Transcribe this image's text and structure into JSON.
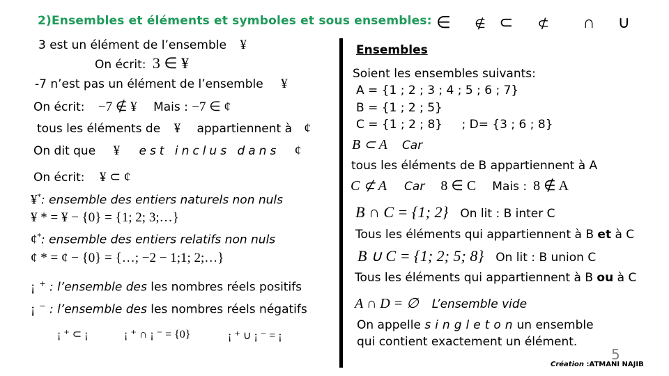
{
  "title": "2)Ensembles et éléments et symboles et sous ensembles:",
  "symbols": [
    {
      "name": "element-of",
      "glyph": "∈"
    },
    {
      "name": "not-element-of",
      "glyph": "∉"
    },
    {
      "name": "subset",
      "glyph": "⊂"
    },
    {
      "name": "not-subset",
      "glyph": "⊄"
    },
    {
      "name": "intersection",
      "glyph": "∩"
    },
    {
      "name": "union",
      "glyph": "∪"
    }
  ],
  "left": {
    "l1_text": "3 est un élément de l’ensemble",
    "l1_set": "¥",
    "l2_label": "On écrit:",
    "l2_math": "3 ∈ ¥",
    "l3_text": "-7  n’est pas un élément de l’ensemble",
    "l3_set": "¥",
    "l4_label": "On écrit:",
    "l4_math": "−7 ∉ ¥",
    "l4_but": "Mais :",
    "l4_math2": "−7 ∈ ¢",
    "l5_text1": "tous les éléments de",
    "l5_set1": "¥",
    "l5_text2": "appartiennent à",
    "l5_set2": "¢",
    "l6_text1": "On dit que",
    "l6_set1": "¥",
    "l6_text2": "est inclus dans",
    "l6_set2": "¢",
    "l7_label": "On écrit:",
    "l7_math": "¥  ⊂ ¢",
    "n_star_def_sym": "¥",
    "n_star_def_sup": "*",
    "n_star_def_text": ": ensemble des entiers naturels non nuls",
    "n_star_eq": "¥ * = ¥ − {0} = {1; 2; 3;…}",
    "z_star_def_sym": "¢",
    "z_star_def_sup": "*",
    "z_star_def_text": ": ensemble des entiers relatifs non nuls",
    "z_star_eq": "¢ * = ¢ − {0} = {…; −2 − 1;1; 2;…}",
    "rplus_sym": "¡",
    "rplus_sup": "+",
    "rplus_it": " : l’ensemble des",
    "rplus_text": " les nombres  réels positifs",
    "rminus_sym": "¡",
    "rminus_sup": "−",
    "rminus_it": " : l’ensemble des",
    "rminus_text": " les nombres  réels négatifs",
    "r_rel1": "¡ ⁺ ⊂ ¡",
    "r_rel2": "¡ ⁺ ∩ ¡ ⁻ = {0}",
    "r_rel3": "¡ ⁺ ∪ ¡ ⁻ = ¡"
  },
  "right": {
    "heading": "Ensembles",
    "intro": "Soient les ensembles suivants:",
    "set_a": "A = {1 ; 2 ; 3 ; 4 ; 5 ; 6 ; 7}",
    "set_b": "B = {1 ; 2 ; 5}",
    "set_c": "C = {1 ; 2 ; 8}",
    "set_d": "; D= {3 ; 6 ; 8}",
    "b_sub_a": "B ⊂ A",
    "car1": "Car",
    "b_in_a_text": "tous les éléments de  B  appartiennent à A",
    "c_notsub_a": "C ⊄ A",
    "car2": "Car",
    "eight_in_c": "8 ∈ C",
    "but": "Mais :",
    "eight_notin_a": "8 ∉ A",
    "b_inter_c": "B ∩ C = {1; 2}",
    "inter_read": "On lit : B inter C",
    "inter_desc_pre": "Tous les éléments qui appartiennent à B ",
    "inter_desc_bold": "et",
    "inter_desc_post": " à C",
    "b_union_c": "B ∪ C = {1; 2; 5; 8}",
    "union_read": "On lit : B union C",
    "union_desc_pre": "Tous les éléments qui appartiennent à B ",
    "union_desc_bold": "ou",
    "union_desc_post": " à C",
    "a_inter_d": "A ∩ D = ∅",
    "empty_label": "L’ensemble vide",
    "singleton_pre": "On appelle",
    "singleton_word": "singleton",
    "singleton_post": "un ensemble",
    "singleton_line2": "qui contient exactement un élément."
  },
  "footer": {
    "page_number": "5",
    "credit_label": "Création",
    "credit_name": " :ATMANI NAJIB"
  },
  "colors": {
    "title": "#1f9a5a",
    "page_number": "#808080",
    "divider": "#000000"
  }
}
